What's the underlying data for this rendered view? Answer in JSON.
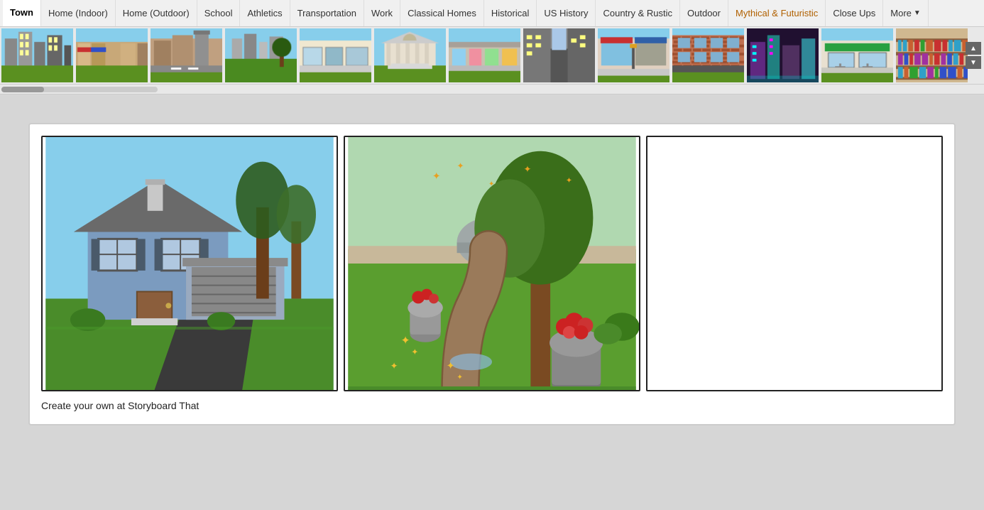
{
  "nav": {
    "tabs": [
      {
        "id": "town",
        "label": "Town",
        "active": true
      },
      {
        "id": "home-indoor",
        "label": "Home (Indoor)",
        "active": false
      },
      {
        "id": "home-outdoor",
        "label": "Home (Outdoor)",
        "active": false
      },
      {
        "id": "school",
        "label": "School",
        "active": false
      },
      {
        "id": "athletics",
        "label": "Athletics",
        "active": false
      },
      {
        "id": "transportation",
        "label": "Transportation",
        "active": false
      },
      {
        "id": "work",
        "label": "Work",
        "active": false
      },
      {
        "id": "classical-homes",
        "label": "Classical Homes",
        "active": false
      },
      {
        "id": "historical",
        "label": "Historical",
        "active": false
      },
      {
        "id": "us-history",
        "label": "US History",
        "active": false
      },
      {
        "id": "country-rustic",
        "label": "Country & Rustic",
        "active": false
      },
      {
        "id": "outdoor",
        "label": "Outdoor",
        "active": false
      },
      {
        "id": "mythical-futuristic",
        "label": "Mythical & Futuristic",
        "active": false
      },
      {
        "id": "close-ups",
        "label": "Close Ups",
        "active": false
      },
      {
        "id": "more",
        "label": "More",
        "active": false,
        "hasArrow": true
      }
    ]
  },
  "thumbnails": [
    {
      "id": 1,
      "alt": "Town scene 1"
    },
    {
      "id": 2,
      "alt": "Town scene 2"
    },
    {
      "id": 3,
      "alt": "Town scene 3"
    },
    {
      "id": 4,
      "alt": "Town scene 4"
    },
    {
      "id": 5,
      "alt": "Town scene 5"
    },
    {
      "id": 6,
      "alt": "Town scene 6"
    },
    {
      "id": 7,
      "alt": "Town scene 7"
    },
    {
      "id": 8,
      "alt": "Town scene 8"
    },
    {
      "id": 9,
      "alt": "Town scene 9"
    },
    {
      "id": 10,
      "alt": "Town scene 10"
    },
    {
      "id": 11,
      "alt": "Town scene 11"
    },
    {
      "id": 12,
      "alt": "Town scene 12"
    },
    {
      "id": 13,
      "alt": "Town scene 13"
    }
  ],
  "storyboard": {
    "caption": "Create your own at Storyboard That",
    "cells": [
      {
        "id": 1,
        "type": "house-exterior",
        "empty": false
      },
      {
        "id": 2,
        "type": "garden-path",
        "empty": false
      },
      {
        "id": 3,
        "type": "empty",
        "empty": true
      }
    ]
  },
  "scroll_up_label": "▲",
  "scroll_down_label": "▼"
}
